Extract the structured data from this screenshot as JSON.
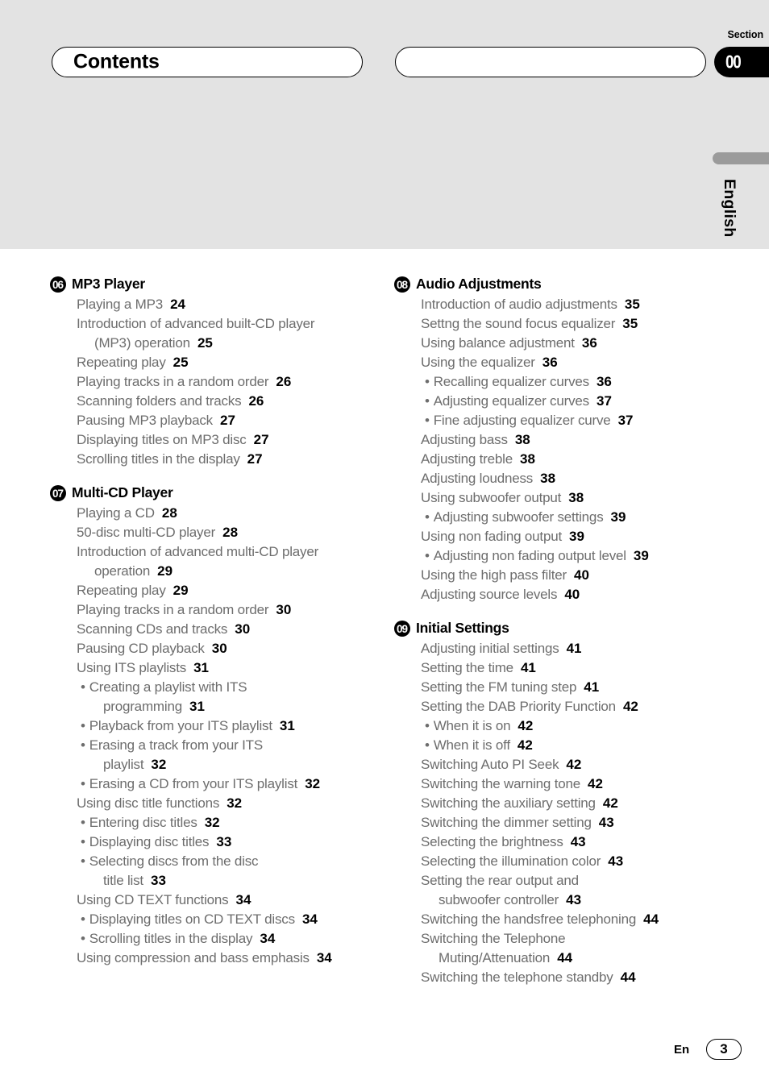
{
  "header": {
    "title": "Contents",
    "second_pill_text": "",
    "section_label": "Section",
    "section_number": "00",
    "language_tab": "English"
  },
  "footer": {
    "language_code": "En",
    "page_number": "3"
  },
  "columns": {
    "left": [
      {
        "number": "06",
        "title": "MP3 Player",
        "entries": [
          {
            "level": "main",
            "text": "Playing a MP3",
            "page": "24",
            "cont": ""
          },
          {
            "level": "main",
            "text": "Introduction of advanced built-CD player",
            "cont": "(MP3) operation",
            "page": "25"
          },
          {
            "level": "main",
            "text": "Repeating play",
            "page": "25",
            "cont": ""
          },
          {
            "level": "main",
            "text": "Playing tracks in a random order",
            "page": "26",
            "cont": ""
          },
          {
            "level": "main",
            "text": "Scanning folders and tracks",
            "page": "26",
            "cont": ""
          },
          {
            "level": "main",
            "text": "Pausing MP3 playback",
            "page": "27",
            "cont": ""
          },
          {
            "level": "main",
            "text": "Displaying titles on MP3 disc",
            "page": "27",
            "cont": ""
          },
          {
            "level": "main",
            "text": "Scrolling titles in the display",
            "page": "27",
            "cont": ""
          }
        ]
      },
      {
        "number": "07",
        "title": "Multi-CD Player",
        "entries": [
          {
            "level": "main",
            "text": "Playing a CD",
            "page": "28",
            "cont": ""
          },
          {
            "level": "main",
            "text": "50-disc multi-CD player",
            "page": "28",
            "cont": ""
          },
          {
            "level": "main",
            "text": "Introduction of advanced multi-CD player",
            "cont": "operation",
            "page": "29"
          },
          {
            "level": "main",
            "text": "Repeating play",
            "page": "29",
            "cont": ""
          },
          {
            "level": "main",
            "text": "Playing tracks in a random order",
            "page": "30",
            "cont": ""
          },
          {
            "level": "main",
            "text": "Scanning CDs and tracks",
            "page": "30",
            "cont": ""
          },
          {
            "level": "main",
            "text": "Pausing CD playback",
            "page": "30",
            "cont": ""
          },
          {
            "level": "main",
            "text": "Using ITS playlists",
            "page": "31",
            "cont": ""
          },
          {
            "level": "sub",
            "text": "Creating a playlist with ITS",
            "cont": "programming",
            "page": "31"
          },
          {
            "level": "sub",
            "text": "Playback from your ITS playlist",
            "page": "31",
            "cont": ""
          },
          {
            "level": "sub",
            "text": "Erasing a track from your ITS",
            "cont": "playlist",
            "page": "32"
          },
          {
            "level": "sub",
            "text": "Erasing a CD from your ITS playlist",
            "page": "32",
            "cont": ""
          },
          {
            "level": "main",
            "text": "Using disc title functions",
            "page": "32",
            "cont": ""
          },
          {
            "level": "sub",
            "text": "Entering disc titles",
            "page": "32",
            "cont": ""
          },
          {
            "level": "sub",
            "text": "Displaying disc titles",
            "page": "33",
            "cont": ""
          },
          {
            "level": "sub",
            "text": "Selecting discs from the disc",
            "cont": "title list",
            "page": "33"
          },
          {
            "level": "main",
            "text": "Using CD TEXT functions",
            "page": "34",
            "cont": ""
          },
          {
            "level": "sub",
            "text": "Displaying titles on CD TEXT discs",
            "page": "34",
            "cont": ""
          },
          {
            "level": "sub",
            "text": "Scrolling titles in the display",
            "page": "34",
            "cont": ""
          },
          {
            "level": "main",
            "text": "Using compression and bass emphasis",
            "page": "34",
            "cont": ""
          }
        ]
      }
    ],
    "right": [
      {
        "number": "08",
        "title": "Audio Adjustments",
        "entries": [
          {
            "level": "main",
            "text": "Introduction of audio adjustments",
            "page": "35",
            "cont": ""
          },
          {
            "level": "main",
            "text": "Settng the sound focus equalizer",
            "page": "35",
            "cont": ""
          },
          {
            "level": "main",
            "text": "Using balance adjustment",
            "page": "36",
            "cont": ""
          },
          {
            "level": "main",
            "text": "Using the equalizer",
            "page": "36",
            "cont": ""
          },
          {
            "level": "sub",
            "text": "Recalling equalizer curves",
            "page": "36",
            "cont": ""
          },
          {
            "level": "sub",
            "text": "Adjusting equalizer curves",
            "page": "37",
            "cont": ""
          },
          {
            "level": "sub",
            "text": "Fine adjusting equalizer curve",
            "page": "37",
            "cont": ""
          },
          {
            "level": "main",
            "text": "Adjusting bass",
            "page": "38",
            "cont": ""
          },
          {
            "level": "main",
            "text": "Adjusting treble",
            "page": "38",
            "cont": ""
          },
          {
            "level": "main",
            "text": "Adjusting loudness",
            "page": "38",
            "cont": ""
          },
          {
            "level": "main",
            "text": "Using subwoofer output",
            "page": "38",
            "cont": ""
          },
          {
            "level": "sub",
            "text": "Adjusting subwoofer settings",
            "page": "39",
            "cont": ""
          },
          {
            "level": "main",
            "text": "Using non fading output",
            "page": "39",
            "cont": ""
          },
          {
            "level": "sub",
            "text": "Adjusting non fading output level",
            "page": "39",
            "cont": ""
          },
          {
            "level": "main",
            "text": "Using the high pass filter",
            "page": "40",
            "cont": ""
          },
          {
            "level": "main",
            "text": "Adjusting source levels",
            "page": "40",
            "cont": ""
          }
        ]
      },
      {
        "number": "09",
        "title": "Initial Settings",
        "entries": [
          {
            "level": "main",
            "text": "Adjusting initial settings",
            "page": "41",
            "cont": ""
          },
          {
            "level": "main",
            "text": "Setting the time",
            "page": "41",
            "cont": ""
          },
          {
            "level": "main",
            "text": "Setting the FM tuning step",
            "page": "41",
            "cont": ""
          },
          {
            "level": "main",
            "text": "Setting the DAB Priority Function",
            "page": "42",
            "cont": ""
          },
          {
            "level": "sub",
            "text": "When it is on",
            "page": "42",
            "cont": ""
          },
          {
            "level": "sub",
            "text": "When it is off",
            "page": "42",
            "cont": ""
          },
          {
            "level": "main",
            "text": "Switching Auto PI Seek",
            "page": "42",
            "cont": ""
          },
          {
            "level": "main",
            "text": "Switching the warning tone",
            "page": "42",
            "cont": ""
          },
          {
            "level": "main",
            "text": "Switching the auxiliary setting",
            "page": "42",
            "cont": ""
          },
          {
            "level": "main",
            "text": "Switching the dimmer setting",
            "page": "43",
            "cont": ""
          },
          {
            "level": "main",
            "text": "Selecting the brightness",
            "page": "43",
            "cont": ""
          },
          {
            "level": "main",
            "text": "Selecting the illumination color",
            "page": "43",
            "cont": ""
          },
          {
            "level": "main",
            "text": "Setting the rear output and",
            "cont": "subwoofer controller",
            "page": "43"
          },
          {
            "level": "main",
            "text": "Switching the handsfree telephoning",
            "page": "44",
            "cont": ""
          },
          {
            "level": "main",
            "text": "Switching the Telephone",
            "cont": "Muting/Attenuation",
            "page": "44"
          },
          {
            "level": "main",
            "text": "Switching the telephone standby",
            "page": "44",
            "cont": ""
          }
        ]
      }
    ]
  }
}
